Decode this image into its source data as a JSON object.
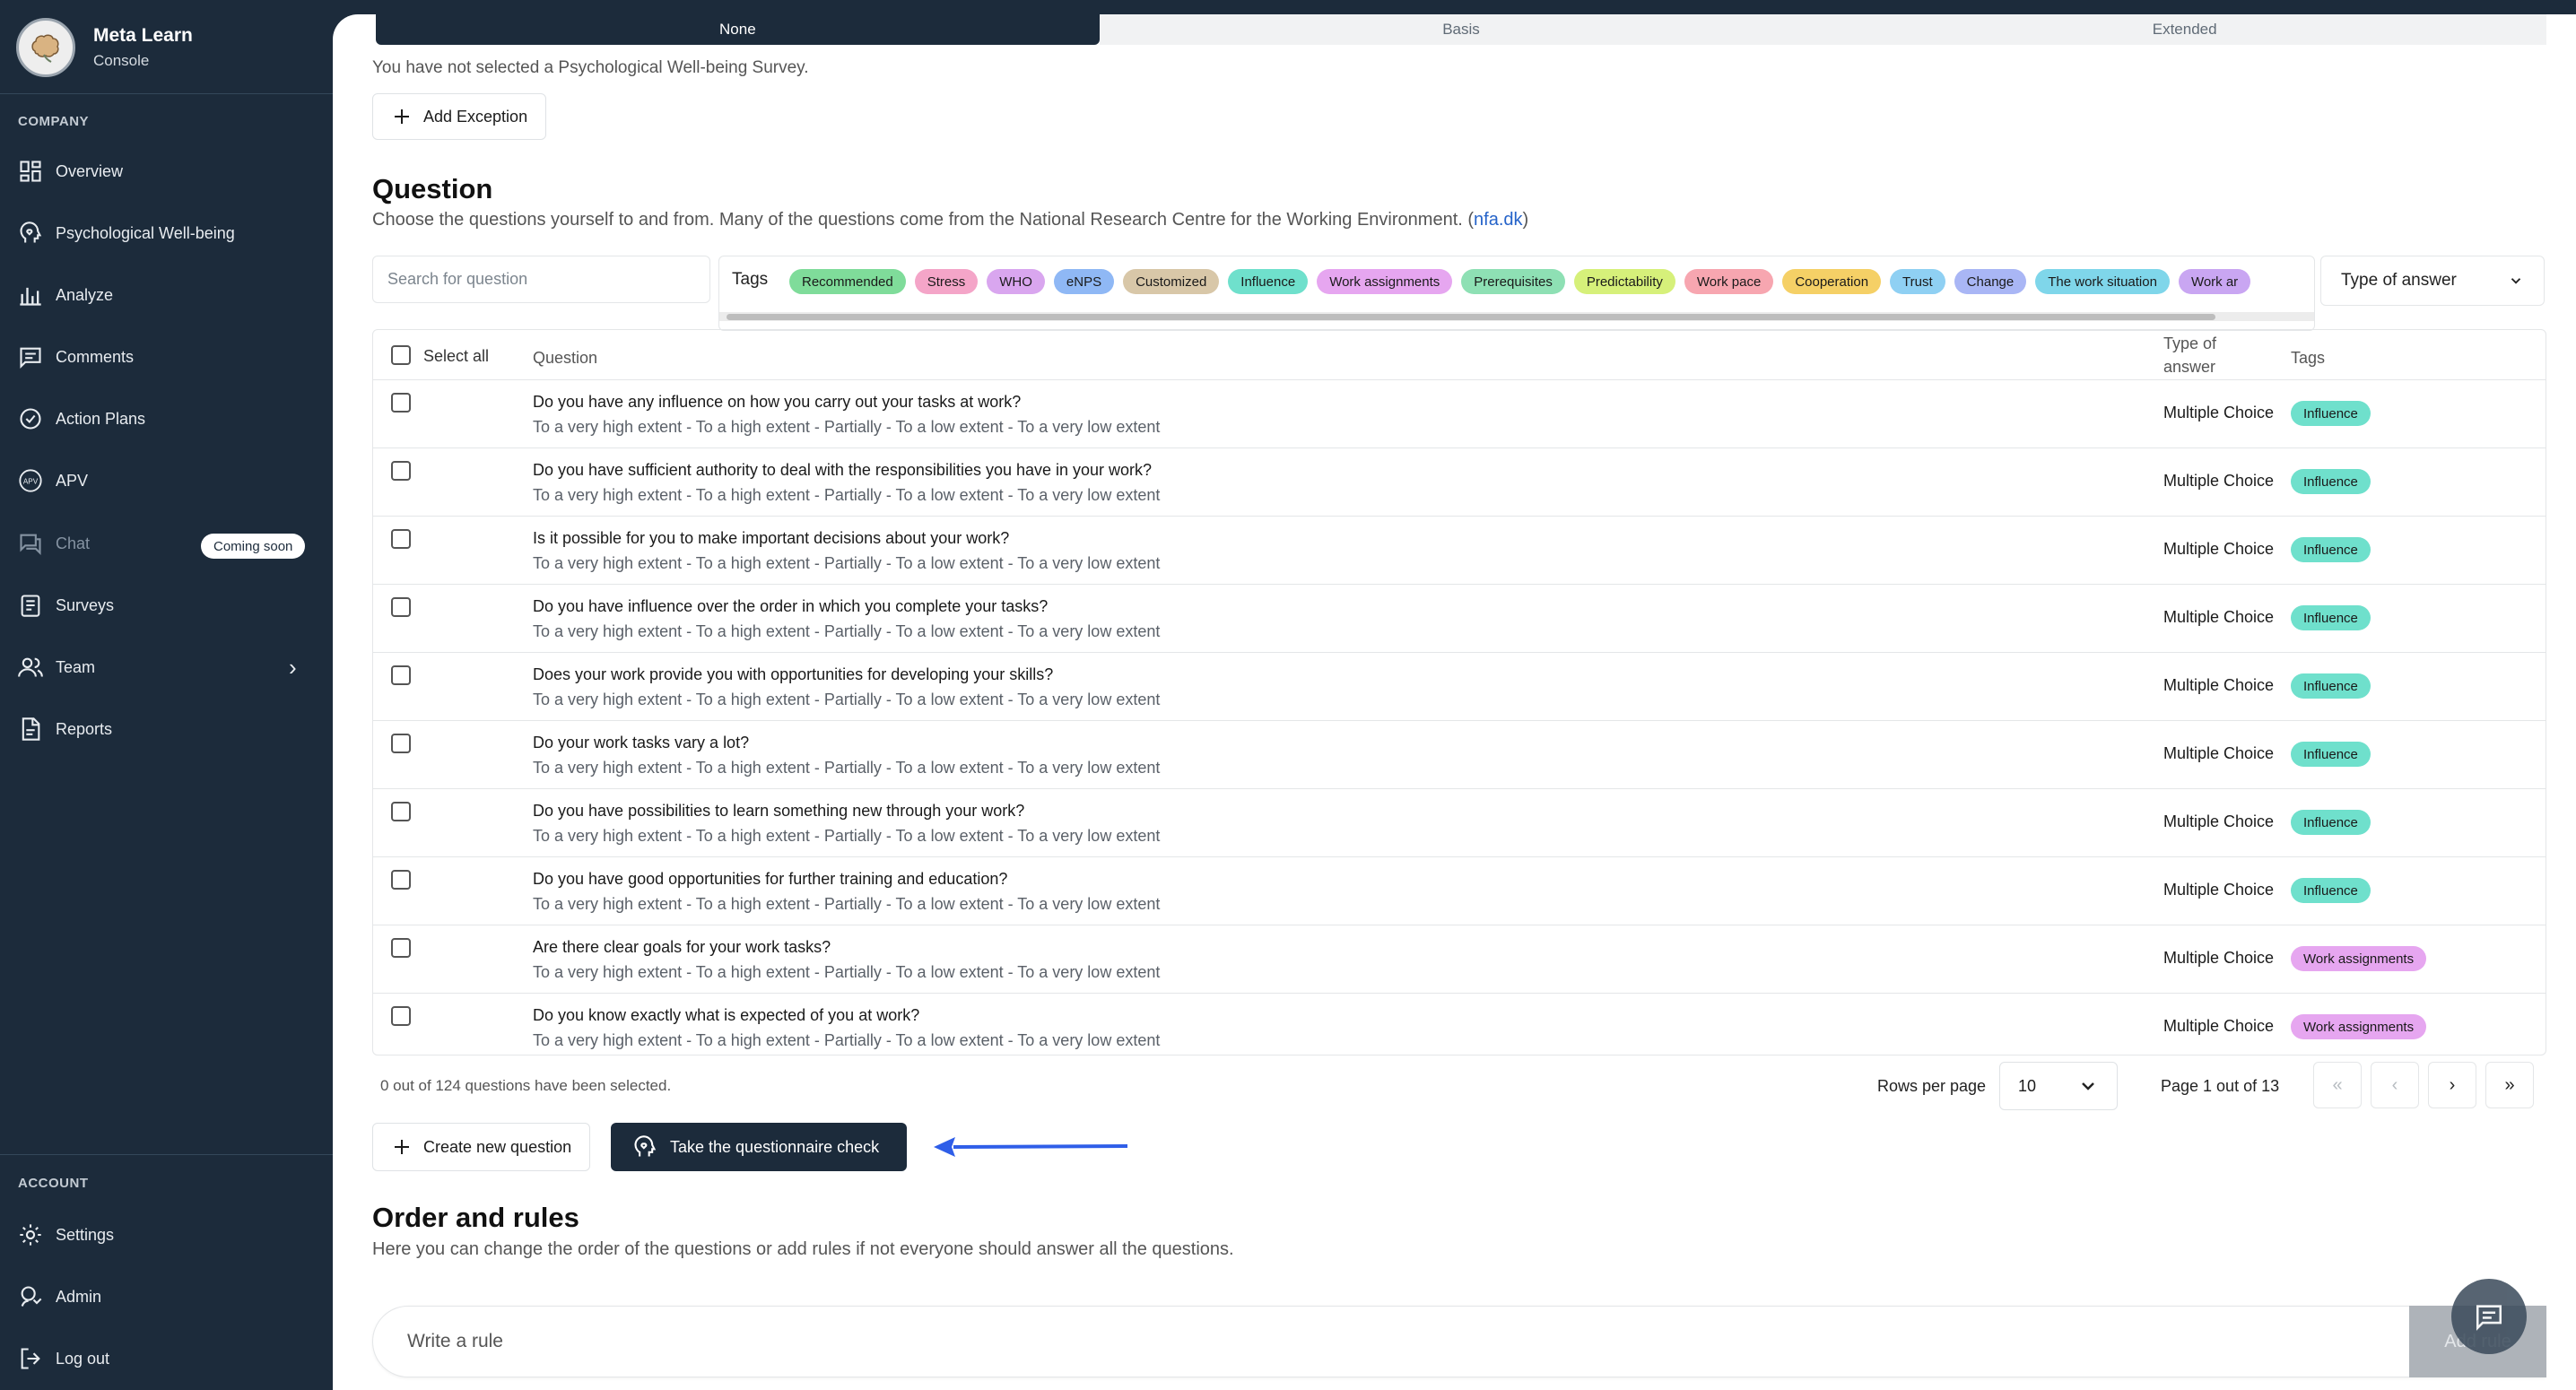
{
  "brand": {
    "name": "Meta Learn",
    "subtitle": "Console"
  },
  "sidebar": {
    "company_label": "COMPANY",
    "items": [
      {
        "label": "Overview",
        "icon": "grid-icon"
      },
      {
        "label": "Psychological Well-being",
        "icon": "head-heart-icon"
      },
      {
        "label": "Analyze",
        "icon": "bar-chart-icon"
      },
      {
        "label": "Comments",
        "icon": "comment-icon"
      },
      {
        "label": "Action Plans",
        "icon": "check-circle-icon"
      },
      {
        "label": "APV",
        "icon": "apv-icon"
      },
      {
        "label": "Chat",
        "icon": "chat-icon",
        "badge": "Coming soon"
      },
      {
        "label": "Surveys",
        "icon": "clipboard-icon"
      },
      {
        "label": "Team",
        "icon": "users-icon"
      },
      {
        "label": "Reports",
        "icon": "document-icon"
      }
    ],
    "account_label": "ACCOUNT",
    "account_items": [
      {
        "label": "Settings",
        "icon": "gear-icon"
      },
      {
        "label": "Admin",
        "icon": "admin-icon"
      },
      {
        "label": "Log out",
        "icon": "logout-icon"
      }
    ]
  },
  "survey_selector": {
    "options": [
      "None",
      "Basis",
      "Extended"
    ],
    "selected": "None"
  },
  "survey_notice": "You have not selected a Psychological Well-being Survey.",
  "add_exception_label": "Add Exception",
  "question_section": {
    "title": "Question",
    "description": "Choose the questions yourself to and from. Many of the questions come from the National Research Centre for the Working Environment. (",
    "link": "nfa.dk",
    "description_end": ")",
    "search_placeholder": "Search for question",
    "tags_label": "Tags",
    "type_of_answer_label": "Type of answer"
  },
  "tags": [
    {
      "label": "Recommended",
      "color": "#7fdc9a"
    },
    {
      "label": "Stress",
      "color": "#f4a5c8"
    },
    {
      "label": "WHO",
      "color": "#d9a6ef"
    },
    {
      "label": "eNPS",
      "color": "#8fb8f5"
    },
    {
      "label": "Customized",
      "color": "#d8c7a8"
    },
    {
      "label": "Influence",
      "color": "#6fe0cc"
    },
    {
      "label": "Work assignments",
      "color": "#e6a6f0"
    },
    {
      "label": "Prerequisites",
      "color": "#8ee0b4"
    },
    {
      "label": "Predictability",
      "color": "#d6f07a"
    },
    {
      "label": "Work pace",
      "color": "#f7a6b0"
    },
    {
      "label": "Cooperation",
      "color": "#f5d066"
    },
    {
      "label": "Trust",
      "color": "#8fd0f3"
    },
    {
      "label": "Change",
      "color": "#a9b6f5"
    },
    {
      "label": "The work situation",
      "color": "#7fd6ea"
    },
    {
      "label": "Work ar",
      "color": "#c9a6f2"
    }
  ],
  "table": {
    "headers": {
      "select_all": "Select all",
      "question": "Question",
      "type_of_answer": "Type of answer",
      "tags": "Tags"
    },
    "rows": [
      {
        "question": "Do you have any influence on how you carry out your tasks at work?",
        "answers": "To a very high extent - To a high extent - Partially - To a low extent - To a very low extent",
        "type": "Multiple Choice",
        "tag": "Influence",
        "tag_color": "#6fe0cc"
      },
      {
        "question": "Do you have sufficient authority to deal with the responsibilities you have in your work?",
        "answers": "To a very high extent - To a high extent - Partially - To a low extent - To a very low extent",
        "type": "Multiple Choice",
        "tag": "Influence",
        "tag_color": "#6fe0cc"
      },
      {
        "question": "Is it possible for you to make important decisions about your work?",
        "answers": "To a very high extent - To a high extent - Partially - To a low extent - To a very low extent",
        "type": "Multiple Choice",
        "tag": "Influence",
        "tag_color": "#6fe0cc"
      },
      {
        "question": "Do you have influence over the order in which you complete your tasks?",
        "answers": "To a very high extent - To a high extent - Partially - To a low extent - To a very low extent",
        "type": "Multiple Choice",
        "tag": "Influence",
        "tag_color": "#6fe0cc"
      },
      {
        "question": "Does your work provide you with opportunities for developing your skills?",
        "answers": "To a very high extent - To a high extent - Partially - To a low extent - To a very low extent",
        "type": "Multiple Choice",
        "tag": "Influence",
        "tag_color": "#6fe0cc"
      },
      {
        "question": "Do your work tasks vary a lot?",
        "answers": "To a very high extent - To a high extent - Partially - To a low extent - To a very low extent",
        "type": "Multiple Choice",
        "tag": "Influence",
        "tag_color": "#6fe0cc"
      },
      {
        "question": "Do you have possibilities to learn something new through your work?",
        "answers": "To a very high extent - To a high extent - Partially - To a low extent - To a very low extent",
        "type": "Multiple Choice",
        "tag": "Influence",
        "tag_color": "#6fe0cc"
      },
      {
        "question": "Do you have good opportunities for further training and education?",
        "answers": "To a very high extent - To a high extent - Partially - To a low extent - To a very low extent",
        "type": "Multiple Choice",
        "tag": "Influence",
        "tag_color": "#6fe0cc"
      },
      {
        "question": "Are there clear goals for your work tasks?",
        "answers": "To a very high extent - To a high extent - Partially - To a low extent - To a very low extent",
        "type": "Multiple Choice",
        "tag": "Work assignments",
        "tag_color": "#e6a6f0"
      },
      {
        "question": "Do you know exactly what is expected of you at work?",
        "answers": "To a very high extent - To a high extent - Partially - To a low extent - To a very low extent",
        "type": "Multiple Choice",
        "tag": "Work assignments",
        "tag_color": "#e6a6f0"
      }
    ]
  },
  "pagination": {
    "selected_text": "0 out of 124 questions have been selected.",
    "rows_per_page_label": "Rows per page",
    "rows_per_page_value": "10",
    "page_text": "Page 1 out of 13",
    "first": "«",
    "prev": "‹",
    "next": "›",
    "last": "»"
  },
  "actions": {
    "create_label": "Create new question",
    "check_label": "Take the questionnaire check"
  },
  "annotation_color": "#2f5ee8",
  "order_section": {
    "title": "Order and rules",
    "description": "Here you can change the order of the questions or add rules if not everyone should answer all the questions.",
    "rule_placeholder": "Write a rule",
    "add_rule_label": "Add rule"
  }
}
